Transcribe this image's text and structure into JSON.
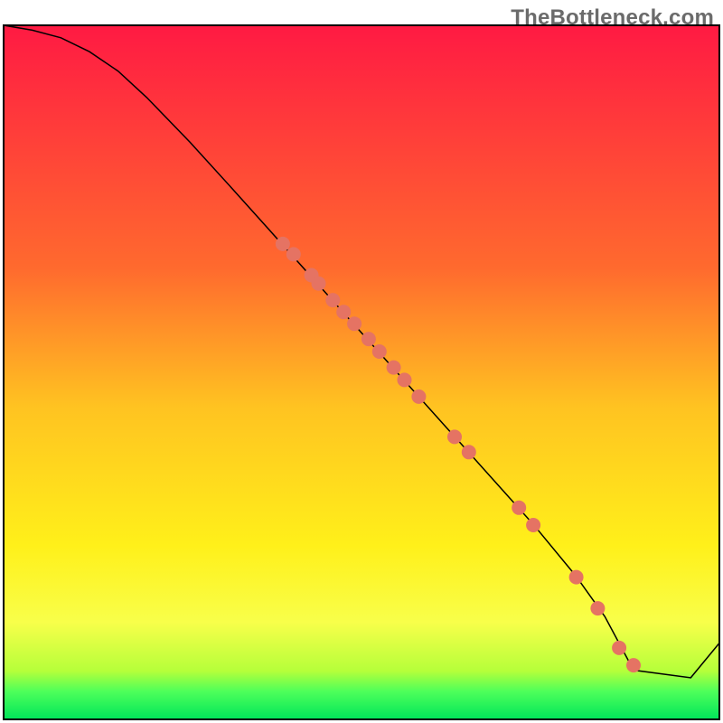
{
  "watermark": "TheBottleneck.com",
  "chart_data": {
    "type": "line",
    "title": "",
    "xlabel": "",
    "ylabel": "",
    "xlim": [
      0,
      100
    ],
    "ylim": [
      0,
      100
    ],
    "gradient_stops": [
      {
        "offset": 0,
        "color": "#ff1a43"
      },
      {
        "offset": 35,
        "color": "#ff6a2e"
      },
      {
        "offset": 55,
        "color": "#ffc321"
      },
      {
        "offset": 75,
        "color": "#fff01a"
      },
      {
        "offset": 86,
        "color": "#f8ff4a"
      },
      {
        "offset": 93,
        "color": "#b6ff3a"
      },
      {
        "offset": 96,
        "color": "#4dff5a"
      },
      {
        "offset": 100,
        "color": "#00e55a"
      }
    ],
    "series": [
      {
        "name": "bottleneck-curve",
        "color": "#000000",
        "stroke_width": 1.5,
        "x": [
          0,
          4,
          8,
          12,
          16,
          20,
          26,
          32,
          38,
          44,
          50,
          56,
          62,
          68,
          74,
          80,
          84,
          88,
          96,
          100
        ],
        "y": [
          100,
          99.3,
          98.2,
          96.2,
          93.4,
          89.6,
          83.2,
          76.4,
          69.5,
          62.6,
          55.7,
          48.8,
          41.9,
          35.0,
          28.1,
          20.6,
          14.8,
          7.1,
          6.0,
          11.0
        ]
      }
    ],
    "scatter": {
      "name": "sample-points",
      "color": "#e57363",
      "radius": 8,
      "x": [
        39,
        40.5,
        43,
        44,
        46,
        47.5,
        49,
        51,
        52.5,
        54.5,
        56,
        58,
        63,
        65,
        72,
        74,
        80,
        83,
        86,
        88
      ],
      "y": [
        68.5,
        67.0,
        64.0,
        62.8,
        60.4,
        58.7,
        57.0,
        54.8,
        53.0,
        50.7,
        48.9,
        46.5,
        40.7,
        38.5,
        30.5,
        28.0,
        20.5,
        16.0,
        10.3,
        7.8
      ]
    }
  }
}
